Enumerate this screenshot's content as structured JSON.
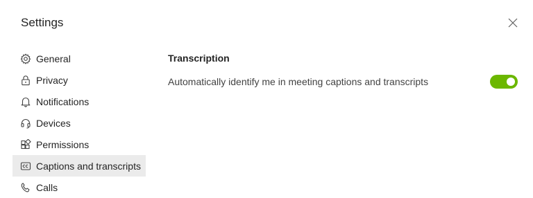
{
  "dialog": {
    "title": "Settings"
  },
  "sidebar": {
    "items": [
      {
        "label": "General",
        "icon": "gear-icon",
        "active": false
      },
      {
        "label": "Privacy",
        "icon": "lock-icon",
        "active": false
      },
      {
        "label": "Notifications",
        "icon": "bell-icon",
        "active": false
      },
      {
        "label": "Devices",
        "icon": "headset-icon",
        "active": false
      },
      {
        "label": "Permissions",
        "icon": "apps-icon",
        "active": false
      },
      {
        "label": "Captions and transcripts",
        "icon": "cc-icon",
        "active": true
      },
      {
        "label": "Calls",
        "icon": "phone-icon",
        "active": false
      }
    ]
  },
  "main": {
    "section_heading": "Transcription",
    "setting": {
      "label": "Automatically identify me in meeting captions and transcripts",
      "toggle_on": true
    }
  },
  "colors": {
    "toggle_on": "#6bb700",
    "active_item_bg": "#ebebeb",
    "text": "#242424"
  }
}
